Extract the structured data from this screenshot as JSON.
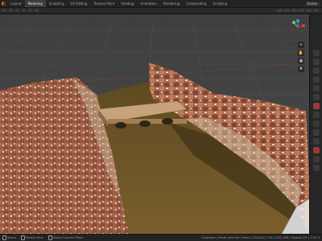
{
  "app": {
    "logo_glyph": "◐"
  },
  "workspaces": [
    "Layout",
    "Modeling",
    "Sculpting",
    "UV Editing",
    "Texture Paint",
    "Shading",
    "Animation",
    "Rendering",
    "Compositing",
    "Scripting"
  ],
  "active_workspace": "Modeling",
  "scene": {
    "name": "Scene"
  },
  "viewport": {
    "tools_icons": [
      "zoom-icon",
      "hand-icon",
      "camera-icon",
      "grid-icon"
    ]
  },
  "status": {
    "left_hint": "Select",
    "mid_hint": "Rotate View",
    "right_hint": "Object Context Menu",
    "right_text": "Collection | Ponte_Vecchio | Verts 1,293,442 | Tris 2,402,186 | Objects 0/1 | 2.90.0"
  },
  "colors": {
    "accent": "#e87d0d",
    "viewport_bg": "#3b3b3b",
    "river": "#6a5228"
  }
}
